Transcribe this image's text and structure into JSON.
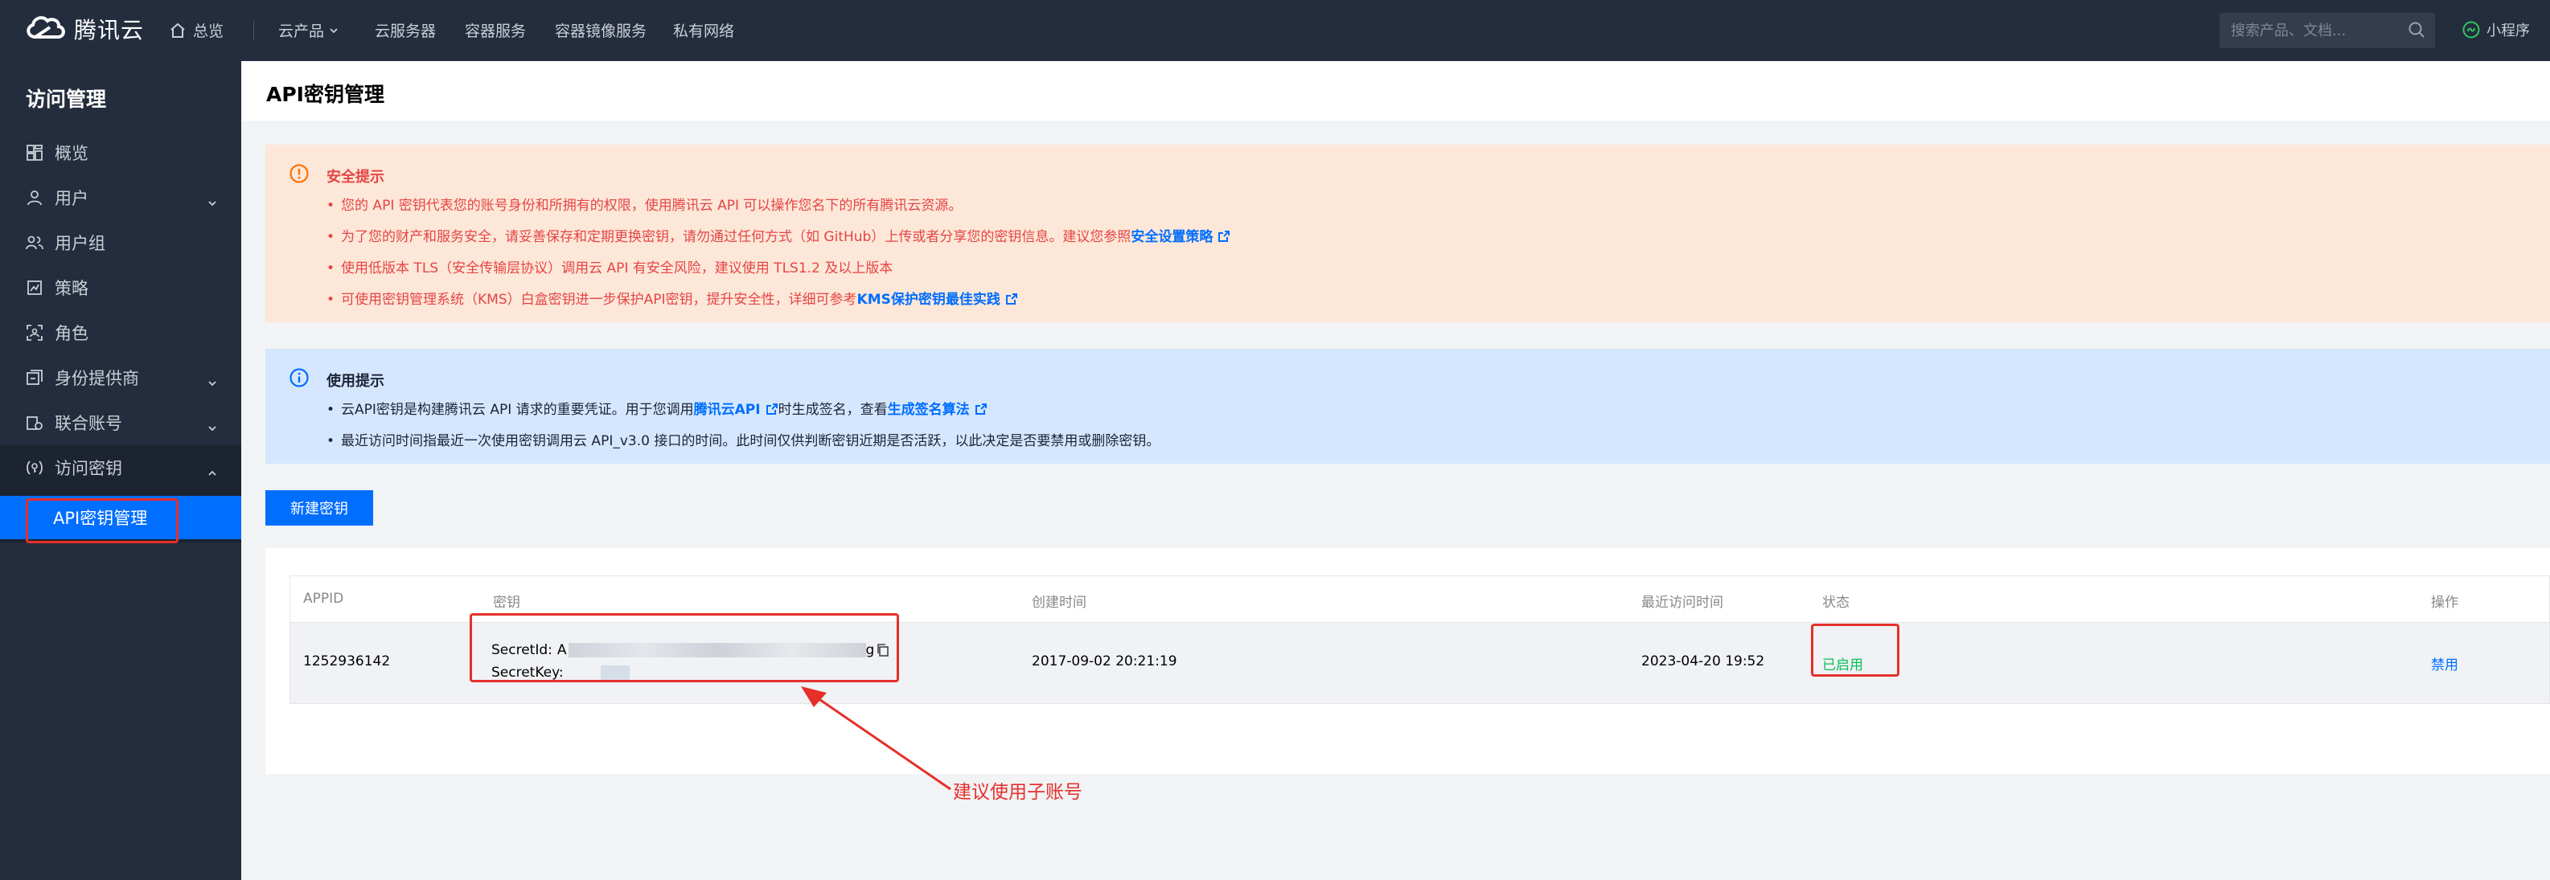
{
  "topbar": {
    "brand": "腾讯云",
    "home": "总览",
    "nav": [
      "云产品",
      "云服务器",
      "容器服务",
      "容器镜像服务",
      "私有网络"
    ],
    "search_placeholder": "搜索产品、文档...",
    "mini_program": "小程序",
    "icons": [
      "tencent-cloud-logo-icon",
      "home-icon",
      "chevron-down-icon",
      "search-icon",
      "wechat-mini-program-icon"
    ]
  },
  "sidebar": {
    "title": "访问管理",
    "items": [
      {
        "label": "概览",
        "icon": "dashboard-icon",
        "expandable": false
      },
      {
        "label": "用户",
        "icon": "user-icon",
        "expandable": true
      },
      {
        "label": "用户组",
        "icon": "user-group-icon",
        "expandable": false
      },
      {
        "label": "策略",
        "icon": "policy-icon",
        "expandable": false
      },
      {
        "label": "角色",
        "icon": "role-icon",
        "expandable": false
      },
      {
        "label": "身份提供商",
        "icon": "identity-provider-icon",
        "expandable": true
      },
      {
        "label": "联合账号",
        "icon": "federated-account-icon",
        "expandable": true
      },
      {
        "label": "访问密钥",
        "icon": "access-key-icon",
        "expandable": true,
        "expanded": true
      }
    ],
    "active_sub": "API密钥管理"
  },
  "page": {
    "title": "API密钥管理"
  },
  "security_notice": {
    "title": "安全提示",
    "items": [
      {
        "text": "您的 API 密钥代表您的账号身份和所拥有的权限，使用腾讯云 API 可以操作您名下的所有腾讯云资源。"
      },
      {
        "text": "为了您的财产和服务安全，请妥善保存和定期更换密钥，请勿通过任何方式（如 GitHub）上传或者分享您的密钥信息。建议您参照",
        "link": "安全设置策略"
      },
      {
        "text": "使用低版本 TLS（安全传输层协议）调用云 API 有安全风险，建议使用 TLS1.2 及以上版本"
      },
      {
        "text": "可使用密钥管理系统（KMS）白盒密钥进一步保护API密钥，提升安全性，详细可参考",
        "link": "KMS保护密钥最佳实践"
      }
    ]
  },
  "usage_notice": {
    "title": "使用提示",
    "item1_before": "云API密钥是构建腾讯云 API 请求的重要凭证。用于您调用",
    "item1_link1": "腾讯云API",
    "item1_middle": "时生成签名，查看",
    "item1_link2": "生成签名算法",
    "item2": "最近访问时间指最近一次使用密钥调用云 API_v3.0 接口的时间。此时间仅供判断密钥近期是否活跃，以此决定是否要禁用或删除密钥。"
  },
  "new_key_button": "新建密钥",
  "table": {
    "columns": [
      "APPID",
      "密钥",
      "创建时间",
      "最近访问时间",
      "状态",
      "操作"
    ],
    "rows": [
      {
        "appid": "1252936142",
        "secret_id_label": "SecretId:",
        "secret_id_value": "A",
        "secret_id_tail": "g",
        "secret_key_label": "SecretKey:",
        "created": "2017-09-02 20:21:19",
        "last_access": "2023-04-20 19:52",
        "status": "已启用",
        "action": "禁用"
      }
    ]
  },
  "annotation": {
    "note": "建议使用子账号",
    "color": "#e5302a"
  },
  "colors": {
    "nav_bg": "#242d3d",
    "accent": "#006eff",
    "warning_bg": "#fde7d8",
    "warning_text": "#e54545",
    "info_bg": "#d5e7fe",
    "status_enabled": "#0abf5b"
  }
}
